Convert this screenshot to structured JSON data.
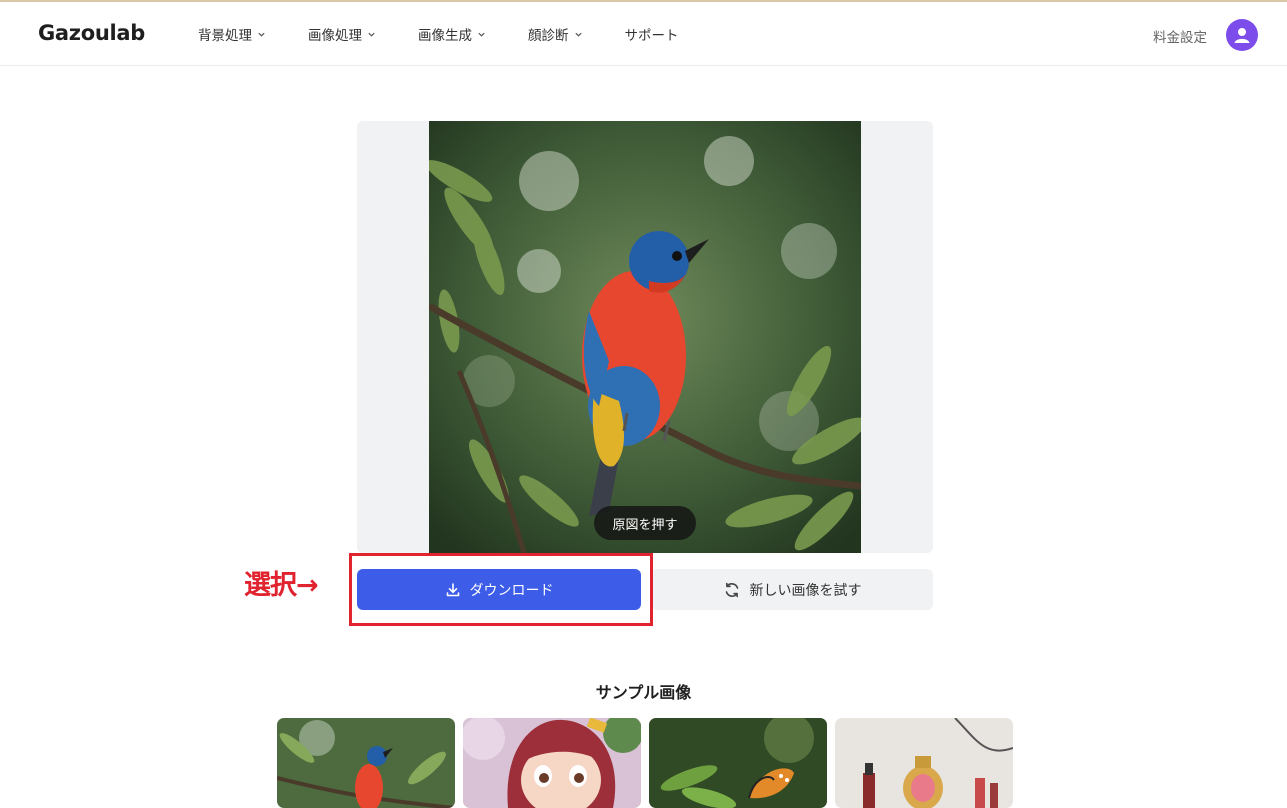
{
  "header": {
    "logo": "Gazoulab",
    "nav": [
      {
        "label": "背景処理",
        "has_dropdown": true
      },
      {
        "label": "画像処理",
        "has_dropdown": true
      },
      {
        "label": "画像生成",
        "has_dropdown": true
      },
      {
        "label": "顔診断",
        "has_dropdown": true
      },
      {
        "label": "サポート",
        "has_dropdown": false
      }
    ],
    "pricing": "料金設定",
    "avatar_icon": "user-icon"
  },
  "preview": {
    "press_original_label": "原図を押す",
    "image_subject": "colorful bird on branch"
  },
  "actions": {
    "download_label": "ダウンロード",
    "download_icon": "download-icon",
    "try_new_label": "新しい画像を試す",
    "try_new_icon": "refresh-icon"
  },
  "annotation": {
    "label": "選択→",
    "color": "#e0232f"
  },
  "samples": {
    "title": "サンプル画像",
    "items": [
      {
        "subject": "bird"
      },
      {
        "subject": "anime-girl"
      },
      {
        "subject": "butterfly"
      },
      {
        "subject": "perfume-bottles"
      }
    ]
  },
  "colors": {
    "accent": "#3d5ce8",
    "avatar": "#7c4dea",
    "panel": "#f1f2f4"
  }
}
